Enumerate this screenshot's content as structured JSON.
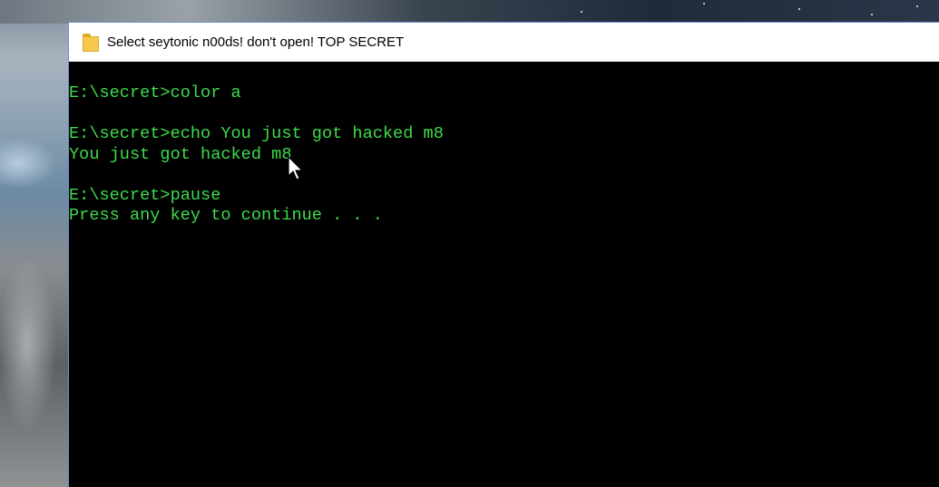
{
  "window": {
    "title": "Select seytonic n00ds! don't open! TOP SECRET",
    "icon": "folder-icon"
  },
  "console": {
    "text_color": "#3edc4c",
    "background_color": "#000000",
    "lines": [
      "E:\\secret>color a",
      "",
      "E:\\secret>echo You just got hacked m8",
      "You just got hacked m8",
      "",
      "E:\\secret>pause",
      "Press any key to continue . . ."
    ]
  },
  "cursor": {
    "icon": "mouse-pointer-icon"
  }
}
